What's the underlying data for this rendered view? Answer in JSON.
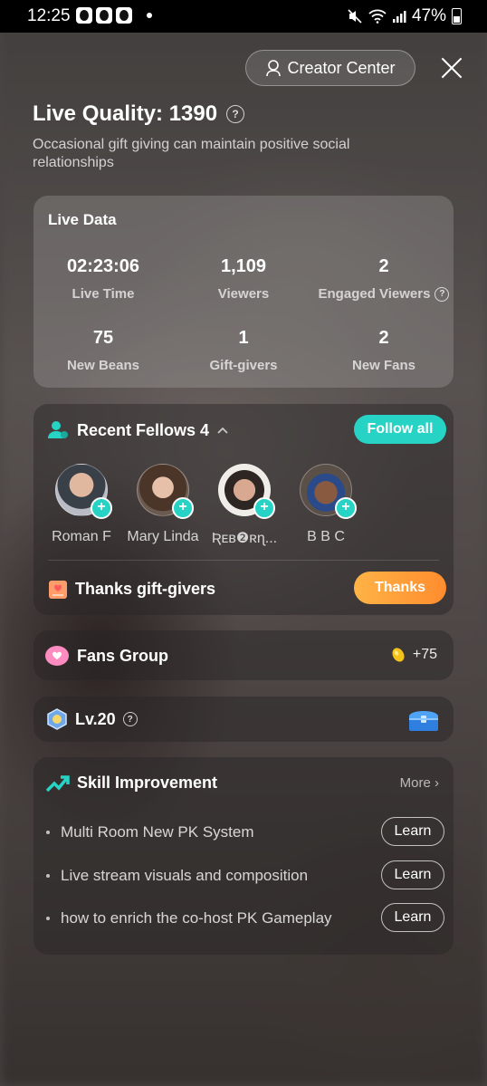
{
  "status_bar": {
    "time": "12:25",
    "battery": "47%"
  },
  "header": {
    "creator_center": "Creator Center"
  },
  "quality": {
    "title": "Live Quality: 1390",
    "subtitle": "Occasional gift giving can maintain positive social relationships"
  },
  "live_data": {
    "title": "Live Data",
    "stats": [
      {
        "value": "02:23:06",
        "label": "Live Time"
      },
      {
        "value": "1,109",
        "label": "Viewers"
      },
      {
        "value": "2",
        "label": "Engaged Viewers"
      },
      {
        "value": "75",
        "label": "New Beans"
      },
      {
        "value": "1",
        "label": "Gift-givers"
      },
      {
        "value": "2",
        "label": "New Fans"
      }
    ]
  },
  "fellows": {
    "title": "Recent Fellows 4",
    "follow_all": "Follow all",
    "people": [
      {
        "name": "Roman F"
      },
      {
        "name": "Mary Linda"
      },
      {
        "name": "Ʀᴇʙ❷ʀɳ..."
      },
      {
        "name": "B B C"
      }
    ],
    "thanks_title": "Thanks gift-givers",
    "thanks_button": "Thanks"
  },
  "fans_group": {
    "title": "Fans Group",
    "beans": "+75"
  },
  "level": {
    "title": "Lv.20"
  },
  "skill": {
    "title": "Skill Improvement",
    "more": "More",
    "items": [
      {
        "text": "Multi Room New PK System",
        "button": "Learn"
      },
      {
        "text": "Live stream visuals and composition",
        "button": "Learn"
      },
      {
        "text": "how to enrich the co-host PK Gameplay",
        "button": "Learn"
      }
    ]
  }
}
